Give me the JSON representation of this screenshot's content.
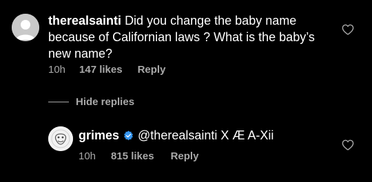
{
  "comment": {
    "username": "therealsainti",
    "text": "Did you change the baby name because of Californian laws ? What is the baby’s new name?",
    "time": "10h",
    "likes": "147 likes",
    "reply_label": "Reply",
    "like_icon": "heart-outline-icon"
  },
  "thread": {
    "hide_replies_label": "Hide replies"
  },
  "reply": {
    "username": "grimes",
    "verified": true,
    "text": "@therealsainti X Æ A-Xii",
    "time": "10h",
    "likes": "815 likes",
    "reply_label": "Reply",
    "like_icon": "heart-outline-icon"
  },
  "colors": {
    "background": "#000000",
    "text": "#ffffff",
    "muted": "#a8a8a8",
    "verified": "#3797f0"
  }
}
